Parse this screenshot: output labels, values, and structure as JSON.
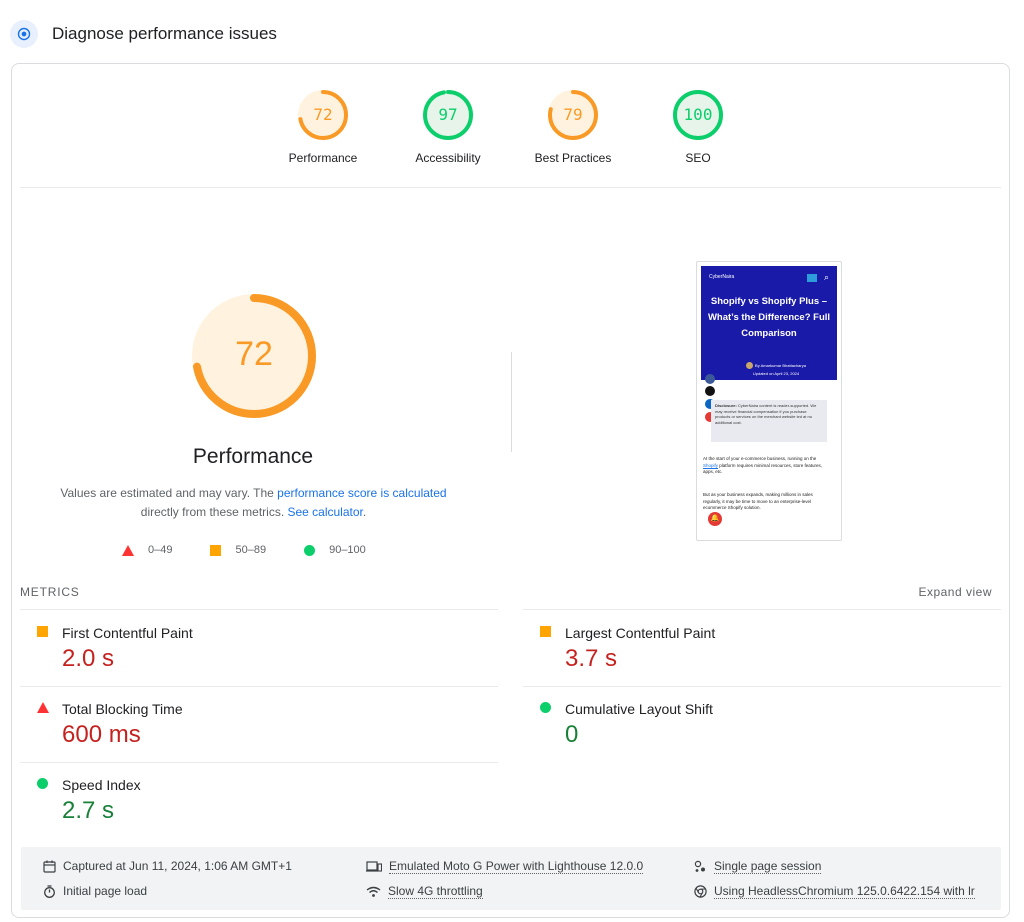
{
  "header": {
    "title": "Diagnose performance issues"
  },
  "gauges": [
    {
      "score": "72",
      "label": "Performance",
      "value": 72,
      "color": "#fa9a26",
      "bg": "#fff3e0"
    },
    {
      "score": "97",
      "label": "Accessibility",
      "value": 97,
      "color": "#0cce6b",
      "bg": "#e6f4ea"
    },
    {
      "score": "79",
      "label": "Best Practices",
      "value": 79,
      "color": "#fa9a26",
      "bg": "#fff3e0"
    },
    {
      "score": "100",
      "label": "SEO",
      "value": 100,
      "color": "#0cce6b",
      "bg": "#e6f4ea"
    }
  ],
  "performance": {
    "score": "72",
    "value": 72,
    "title": "Performance",
    "desc_prefix": "Values are estimated and may vary. The ",
    "desc_link1": "performance score is calculated",
    "desc_middle": " directly from these metrics. ",
    "desc_link2": "See calculator",
    "desc_suffix": "."
  },
  "legend": {
    "fail": "0–49",
    "average": "50–89",
    "pass": "90–100"
  },
  "colors": {
    "fail": "#ff3333",
    "average": "#ffa400",
    "pass": "#0cce6b",
    "link": "#1a73e8"
  },
  "thumbnail": {
    "brand": "CyberNaira",
    "title": "Shopify vs Shopify Plus – What’s the Difference? Full Comparison",
    "author": "By Amarkumar Bhattacharya",
    "updated": "Updated on April 23, 2024",
    "disclosure_bold": "Disclosure:",
    "disclosure": " CyberNaira content is reader-supported. We may receive financial compensation if you purchase products or services on the merchant website led at no additional cost.",
    "para1_a": "At the start of your e-commerce business, running on the ",
    "para1_link": "Shopify",
    "para1_b": " platform requires minimal resources, store features, apps, etc.",
    "para2": "But as your business expands, making millions in sales regularly, it may be time to move to an enterprise-level ecommerce Shopify solution."
  },
  "metrics": {
    "label": "METRICS",
    "expand": "Expand view",
    "items": [
      {
        "name": "First Contentful Paint",
        "value": "2.0 s",
        "status": "average"
      },
      {
        "name": "Largest Contentful Paint",
        "value": "3.7 s",
        "status": "average"
      },
      {
        "name": "Total Blocking Time",
        "value": "600 ms",
        "status": "fail"
      },
      {
        "name": "Cumulative Layout Shift",
        "value": "0",
        "status": "pass"
      },
      {
        "name": "Speed Index",
        "value": "2.7 s",
        "status": "pass"
      }
    ]
  },
  "footer": {
    "captured": "Captured at Jun 11, 2024, 1:06 AM GMT+1",
    "initial": "Initial page load",
    "device": "Emulated Moto G Power with Lighthouse 12.0.0",
    "throttling": "Slow 4G throttling",
    "session": "Single page session",
    "browser": "Using HeadlessChromium 125.0.6422.154 with lr"
  }
}
